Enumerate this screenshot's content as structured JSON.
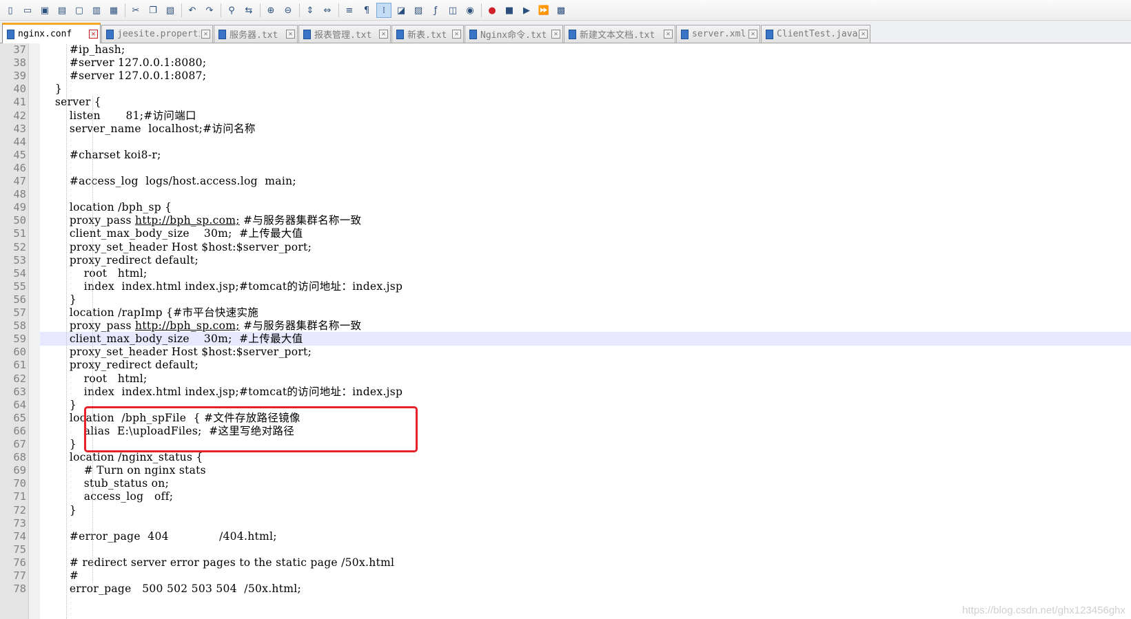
{
  "toolbar": {
    "buttons": [
      {
        "name": "new-file-icon",
        "glyph": "▯"
      },
      {
        "name": "open-file-icon",
        "glyph": "▭"
      },
      {
        "name": "save-icon",
        "glyph": "▣"
      },
      {
        "name": "save-all-icon",
        "glyph": "▤"
      },
      {
        "name": "close-icon",
        "glyph": "▢"
      },
      {
        "name": "close-all-icon",
        "glyph": "▥"
      },
      {
        "name": "print-icon",
        "glyph": "▦"
      },
      {
        "name": "sep"
      },
      {
        "name": "cut-icon",
        "glyph": "✂"
      },
      {
        "name": "copy-icon",
        "glyph": "❐"
      },
      {
        "name": "paste-icon",
        "glyph": "▧"
      },
      {
        "name": "sep"
      },
      {
        "name": "undo-icon",
        "glyph": "↶"
      },
      {
        "name": "redo-icon",
        "glyph": "↷"
      },
      {
        "name": "sep"
      },
      {
        "name": "find-icon",
        "glyph": "⚲"
      },
      {
        "name": "replace-icon",
        "glyph": "⇆"
      },
      {
        "name": "sep"
      },
      {
        "name": "zoom-in-icon",
        "glyph": "⊕"
      },
      {
        "name": "zoom-out-icon",
        "glyph": "⊖"
      },
      {
        "name": "sep"
      },
      {
        "name": "sync-vertical-scroll-icon",
        "glyph": "⇕"
      },
      {
        "name": "sync-horizontal-scroll-icon",
        "glyph": "⇔"
      },
      {
        "name": "sep"
      },
      {
        "name": "word-wrap-icon",
        "glyph": "≡"
      },
      {
        "name": "show-all-characters-icon",
        "glyph": "¶"
      },
      {
        "name": "indent-guide-icon",
        "glyph": "⁞",
        "active": true
      },
      {
        "name": "user-language-icon",
        "glyph": "◪"
      },
      {
        "name": "document-map-icon",
        "glyph": "▨"
      },
      {
        "name": "function-list-icon",
        "glyph": "ƒ"
      },
      {
        "name": "folder-workspace-icon",
        "glyph": "◫"
      },
      {
        "name": "monitoring-icon",
        "glyph": "◉"
      },
      {
        "name": "sep"
      },
      {
        "name": "macro-record-icon",
        "glyph": "●",
        "color": "#d0202a"
      },
      {
        "name": "macro-stop-icon",
        "glyph": "■"
      },
      {
        "name": "macro-play-icon",
        "glyph": "▶"
      },
      {
        "name": "macro-run-multiple-icon",
        "glyph": "⏩"
      },
      {
        "name": "macro-save-icon",
        "glyph": "▩"
      }
    ]
  },
  "tabs": [
    {
      "label": "nginx.conf",
      "active": true
    },
    {
      "label": "jeesite.properties",
      "active": false
    },
    {
      "label": "服务器.txt",
      "active": false
    },
    {
      "label": "报表管理.txt",
      "active": false
    },
    {
      "label": "新表.txt",
      "active": false
    },
    {
      "label": "Nginx命令.txt",
      "active": false
    },
    {
      "label": "新建文本文档.txt",
      "active": false
    },
    {
      "label": "server.xml",
      "active": false
    },
    {
      "label": "ClientTest.java",
      "active": false
    }
  ],
  "tab_close_glyph": "✕",
  "editor": {
    "current_line": 59,
    "lines": [
      {
        "n": "37",
        "text": "        #ip_hash;"
      },
      {
        "n": "38",
        "text": "        #server 127.0.0.1:8080;"
      },
      {
        "n": "39",
        "text": "        #server 127.0.0.1:8087;"
      },
      {
        "n": "40",
        "text": "    }"
      },
      {
        "n": "41",
        "text": "    server {"
      },
      {
        "n": "42",
        "text": "        listen       81;#访问端口"
      },
      {
        "n": "43",
        "text": "        server_name  localhost;#访问名称"
      },
      {
        "n": "44",
        "text": ""
      },
      {
        "n": "45",
        "text": "        #charset koi8-r;"
      },
      {
        "n": "46",
        "text": ""
      },
      {
        "n": "47",
        "text": "        #access_log  logs/host.access.log  main;"
      },
      {
        "n": "48",
        "text": ""
      },
      {
        "n": "49",
        "text": "        location /bph_sp {"
      },
      {
        "n": "50",
        "pre": "        proxy_pass ",
        "url": "http://bph_sp.com;",
        "post": " #与服务器集群名称一致"
      },
      {
        "n": "51",
        "text": "        client_max_body_size    30m;  #上传最大值"
      },
      {
        "n": "52",
        "text": "        proxy_set_header Host $host:$server_port;"
      },
      {
        "n": "53",
        "text": "        proxy_redirect default;"
      },
      {
        "n": "54",
        "text": "            root   html;"
      },
      {
        "n": "55",
        "text": "            index  index.html index.jsp;#tomcat的访问地址：index.jsp"
      },
      {
        "n": "56",
        "text": "        }"
      },
      {
        "n": "57",
        "text": "        location /rapImp {#市平台快速实施"
      },
      {
        "n": "58",
        "pre": "        proxy_pass ",
        "url": "http://bph_sp.com;",
        "post": " #与服务器集群名称一致"
      },
      {
        "n": "59",
        "text": "        client_max_body_size    30m;  #上传最大值"
      },
      {
        "n": "60",
        "text": "        proxy_set_header Host $host:$server_port;"
      },
      {
        "n": "61",
        "text": "        proxy_redirect default;"
      },
      {
        "n": "62",
        "text": "            root   html;"
      },
      {
        "n": "63",
        "text": "            index  index.html index.jsp;#tomcat的访问地址：index.jsp"
      },
      {
        "n": "64",
        "text": "        }"
      },
      {
        "n": "65",
        "text": "        location  /bph_spFile  { #文件存放路径镜像"
      },
      {
        "n": "66",
        "text": "            alias  E:\\uploadFiles;  #这里写绝对路径"
      },
      {
        "n": "67",
        "text": "        }"
      },
      {
        "n": "68",
        "text": "        location /nginx_status {"
      },
      {
        "n": "69",
        "text": "            # Turn on nginx stats"
      },
      {
        "n": "70",
        "text": "            stub_status on;"
      },
      {
        "n": "71",
        "text": "            access_log   off;"
      },
      {
        "n": "72",
        "text": "        }"
      },
      {
        "n": "73",
        "text": ""
      },
      {
        "n": "74",
        "text": "        #error_page  404              /404.html;"
      },
      {
        "n": "75",
        "text": ""
      },
      {
        "n": "76",
        "text": "        # redirect server error pages to the static page /50x.html"
      },
      {
        "n": "77",
        "text": "        #"
      },
      {
        "n": "78",
        "text": "        error_page   500 502 503 504  /50x.html;"
      }
    ]
  },
  "highlight_color": "#e8202a",
  "watermark": "https://blog.csdn.net/ghx123456ghx"
}
